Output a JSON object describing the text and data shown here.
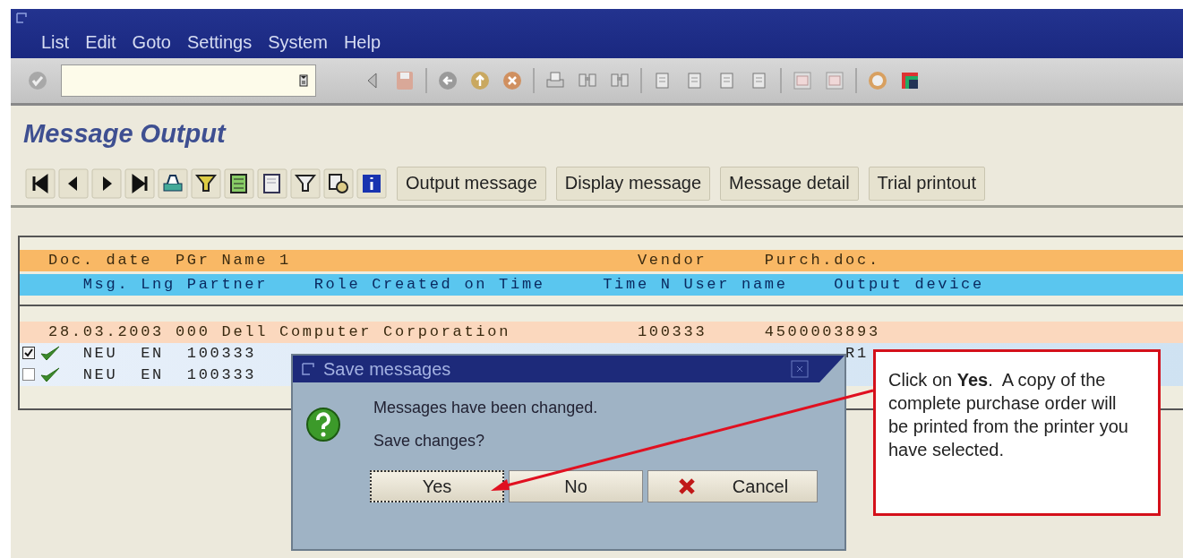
{
  "window": {
    "menu": [
      {
        "label": "List"
      },
      {
        "label": "Edit"
      },
      {
        "label": "Goto"
      },
      {
        "label": "Settings"
      },
      {
        "label": "System"
      },
      {
        "label": "Help"
      }
    ]
  },
  "screen_title": "Message Output",
  "app_toolbar": {
    "buttons": [
      {
        "label": "Output message"
      },
      {
        "label": "Display message"
      },
      {
        "label": "Message detail"
      },
      {
        "label": "Trial printout"
      }
    ]
  },
  "list": {
    "header_rows": [
      {
        "kind": "document",
        "cells": [
          "Doc. date",
          "PGr",
          "Name 1",
          "Vendor",
          "Purch.doc."
        ]
      },
      {
        "kind": "message",
        "cells": [
          "Msg.",
          "Lng",
          "Partner",
          "Role",
          "Created on",
          "Time",
          "Time",
          "N",
          "User name",
          "Output device"
        ]
      }
    ],
    "document_row": {
      "cells": [
        "28.03.2003",
        "000",
        "Dell Computer Corporation",
        "100333",
        "4500003893"
      ]
    },
    "message_rows": [
      {
        "checked": true,
        "cells": [
          "NEU",
          "EN",
          "100333"
        ],
        "output_device": "R1"
      },
      {
        "checked": false,
        "cells": [
          "NEU",
          "EN",
          "100333"
        ]
      }
    ]
  },
  "dialog": {
    "title": "Save messages",
    "lines": [
      "Messages have been changed.",
      "Save changes?"
    ],
    "buttons": [
      {
        "kind": "yes",
        "label": "Yes",
        "focused": true
      },
      {
        "kind": "no",
        "label": "No",
        "focused": false
      },
      {
        "kind": "cancel",
        "label": "Cancel",
        "focused": false
      }
    ]
  },
  "callout": {
    "text": "Click on **Yes**.  A copy of the complete purchase order will be printed from the printer you have selected."
  }
}
